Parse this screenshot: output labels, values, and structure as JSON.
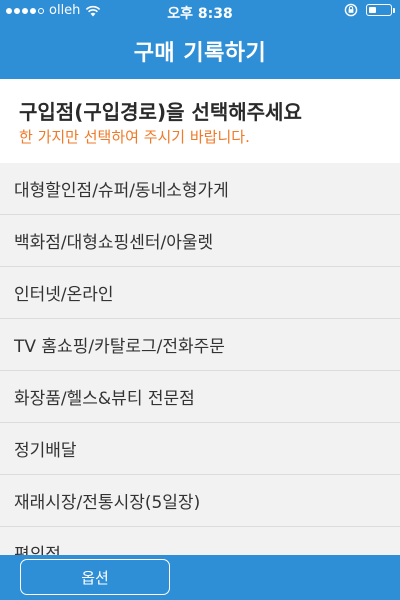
{
  "status_bar": {
    "carrier": "olleh",
    "time": "오후 8:38",
    "signal_bars_filled": 4,
    "signal_bars_total": 5,
    "battery_level": 0.35
  },
  "nav": {
    "title": "구매 기록하기"
  },
  "header": {
    "title": "구입점(구입경로)을 선택해주세요",
    "subtitle": "한 가지만 선택하여 주시기 바랍니다."
  },
  "options": [
    "대형할인점/슈퍼/동네소형가게",
    "백화점/대형쇼핑센터/아울렛",
    "인터넷/온라인",
    "TV 홈쇼핑/카탈로그/전화주문",
    "화장품/헬스&뷰티 전문점",
    "정기배달",
    "재래시장/전통시장(5일장)",
    "편의점"
  ],
  "footer": {
    "option_button_label": "옵션"
  },
  "colors": {
    "primary": "#2f8fd6",
    "accent_orange": "#f07a28",
    "list_bg": "#f2f2f2"
  },
  "icons": [
    "signal-dots-icon",
    "wifi-icon",
    "rotation-lock-icon",
    "battery-icon"
  ]
}
